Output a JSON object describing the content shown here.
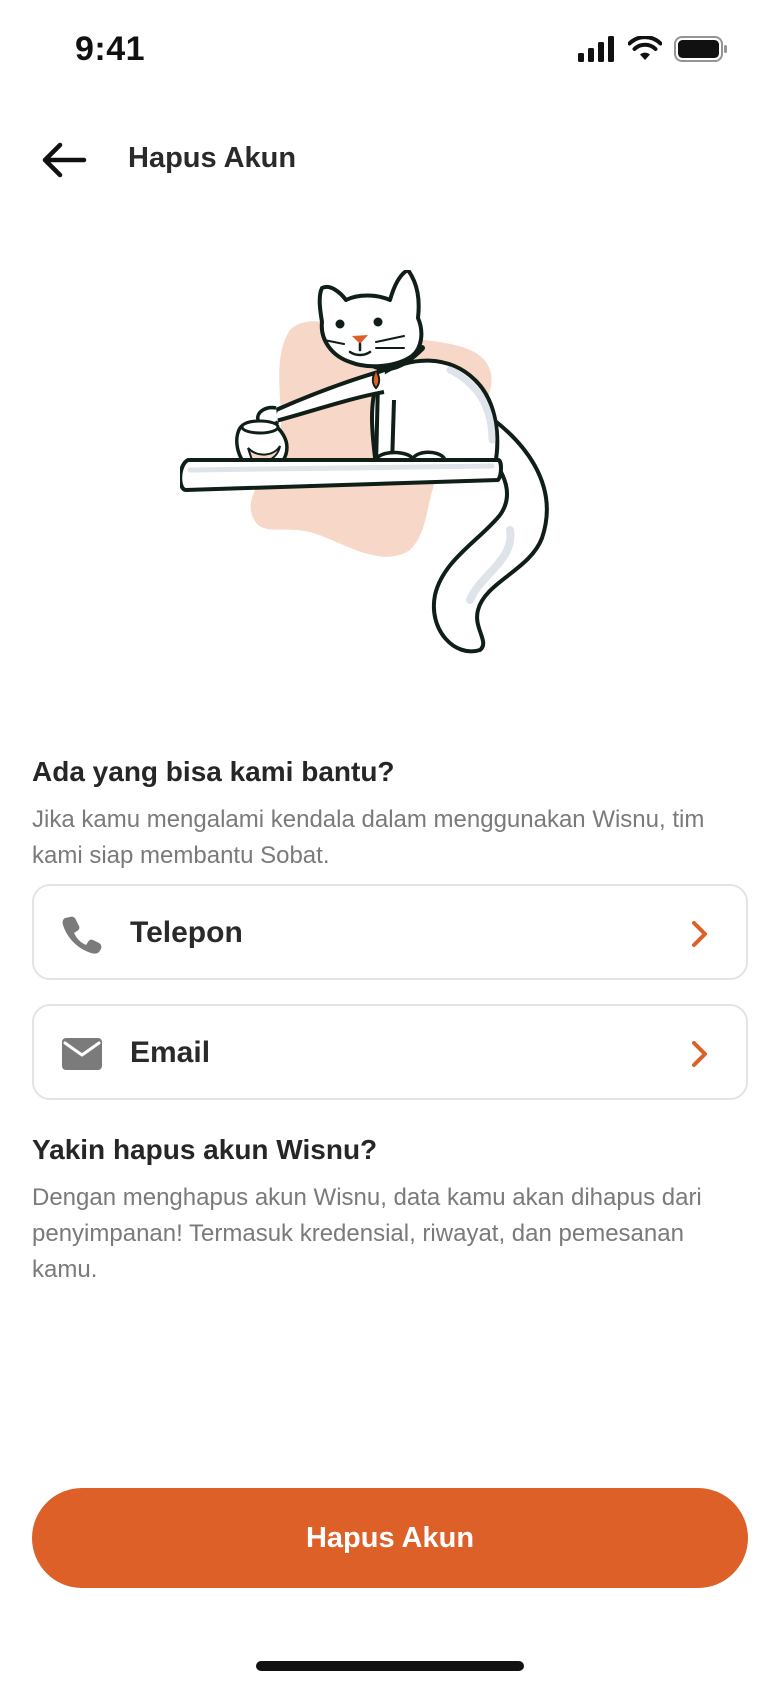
{
  "status_bar": {
    "time": "9:41",
    "icons": [
      "signal-icon",
      "wifi-icon",
      "battery-icon"
    ]
  },
  "header": {
    "back_icon": "arrow-left-icon",
    "title": "Hapus Akun"
  },
  "illustration": {
    "icon": "cat-on-shelf-illustration"
  },
  "help": {
    "title": "Ada yang bisa kami bantu?",
    "description": "Jika kamu mengalami kendala dalam menggunakan Wisnu, tim kami siap membantu Sobat."
  },
  "contacts": [
    {
      "label": "Telepon",
      "icon": "phone-icon",
      "chevron": "chevron-right-icon"
    },
    {
      "label": "Email",
      "icon": "mail-icon",
      "chevron": "chevron-right-icon"
    }
  ],
  "confirm": {
    "title": "Yakin hapus akun Wisnu?",
    "description": "Dengan menghapus akun Wisnu, data kamu akan dihapus dari penyimpanan! Termasuk kredensial, riwayat, dan pemesanan kamu."
  },
  "actions": {
    "delete_label": "Hapus Akun"
  },
  "colors": {
    "accent": "#dd6029",
    "blob": "#f7d7c8",
    "text_muted": "#7a7a7a",
    "border": "#e4e4e4"
  }
}
